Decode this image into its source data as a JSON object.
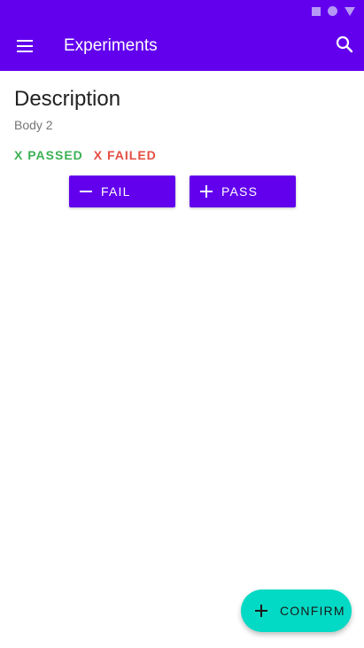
{
  "app_bar": {
    "title": "Experiments",
    "menu_icon": "menu-icon",
    "search_icon": "search-icon",
    "color": "#6200ee"
  },
  "status_bar": {
    "icons": [
      "square-icon",
      "circle-icon",
      "triangle-icon"
    ]
  },
  "content": {
    "description_title": "Description",
    "description_body": "Body 2",
    "passed_label": "X PASSED",
    "failed_label": "X FAILED",
    "passed_color": "#3cb155",
    "failed_color": "#e54d42"
  },
  "actions": {
    "fail_label": "FAIL",
    "pass_label": "PASS"
  },
  "fab": {
    "label": "CONFIRM",
    "color": "#03dac5"
  }
}
